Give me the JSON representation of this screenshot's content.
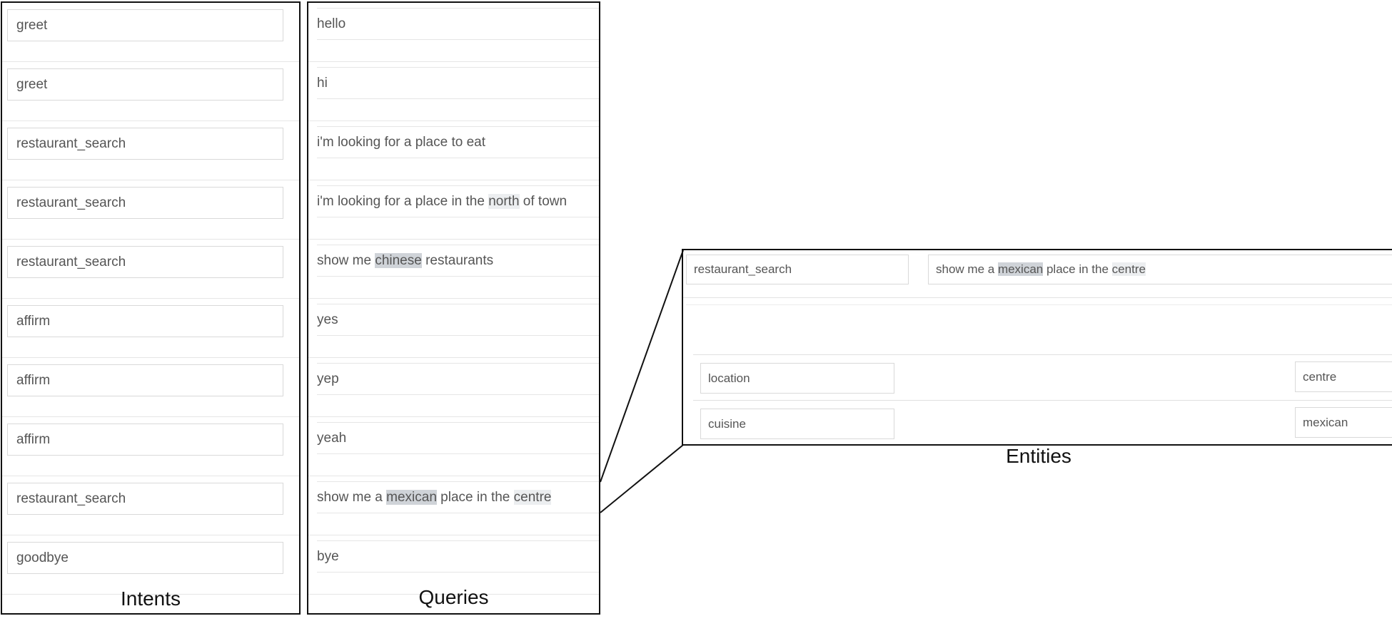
{
  "intents": {
    "caption": "Intents",
    "items": [
      "greet",
      "greet",
      "restaurant_search",
      "restaurant_search",
      "restaurant_search",
      "affirm",
      "affirm",
      "affirm",
      "restaurant_search",
      "goodbye"
    ]
  },
  "queries": {
    "caption": "Queries",
    "items": [
      [
        {
          "text": "hello",
          "hl": ""
        }
      ],
      [
        {
          "text": "hi",
          "hl": ""
        }
      ],
      [
        {
          "text": "i'm looking for a place to eat",
          "hl": ""
        }
      ],
      [
        {
          "text": "i'm looking for a place in the ",
          "hl": ""
        },
        {
          "text": "north",
          "hl": "light"
        },
        {
          "text": " of town",
          "hl": ""
        }
      ],
      [
        {
          "text": "show me ",
          "hl": ""
        },
        {
          "text": "chinese",
          "hl": "dark"
        },
        {
          "text": " restaurants",
          "hl": ""
        }
      ],
      [
        {
          "text": "yes",
          "hl": ""
        }
      ],
      [
        {
          "text": "yep",
          "hl": ""
        }
      ],
      [
        {
          "text": "yeah",
          "hl": ""
        }
      ],
      [
        {
          "text": "show me a ",
          "hl": ""
        },
        {
          "text": "mexican",
          "hl": "dark"
        },
        {
          "text": " place in the ",
          "hl": ""
        },
        {
          "text": "centre",
          "hl": "light"
        }
      ],
      [
        {
          "text": "bye",
          "hl": ""
        }
      ]
    ]
  },
  "detail": {
    "intent": "restaurant_search",
    "query": [
      {
        "text": "show me a ",
        "hl": ""
      },
      {
        "text": "mexican",
        "hl": "dark"
      },
      {
        "text": " place in the ",
        "hl": ""
      },
      {
        "text": "centre",
        "hl": "light"
      }
    ],
    "entities": [
      {
        "name": "location",
        "value": "centre"
      },
      {
        "name": "cuisine",
        "value": "mexican"
      }
    ],
    "caption": "Entities"
  }
}
